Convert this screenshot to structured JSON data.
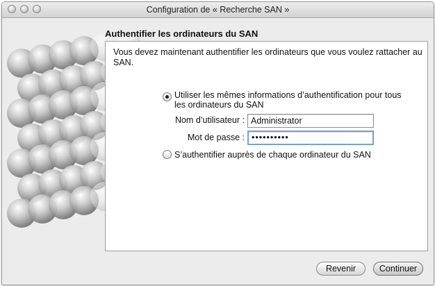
{
  "window": {
    "title": "Configuration de « Recherche SAN »"
  },
  "page": {
    "heading": "Authentifier les ordinateurs du SAN",
    "intro": "Vous devez maintenant authentifier les ordinateurs que vous voulez rattacher au SAN."
  },
  "options": {
    "same_credentials": {
      "label": "Utiliser les mêmes informations d’authentification pour tous les ordinateurs du SAN",
      "selected": true
    },
    "per_computer": {
      "label": "S’authentifier auprès de chaque ordinateur du SAN",
      "selected": false
    }
  },
  "form": {
    "username_label": "Nom d’utilisateur :",
    "username_value": "Administrator",
    "password_label": "Mot de passe :",
    "password_value": "••••••••••"
  },
  "buttons": {
    "back": "Revenir",
    "continue": "Continuer"
  },
  "colors": {
    "focus_ring": "#7a9fd3",
    "window_bg": "#ececec"
  }
}
